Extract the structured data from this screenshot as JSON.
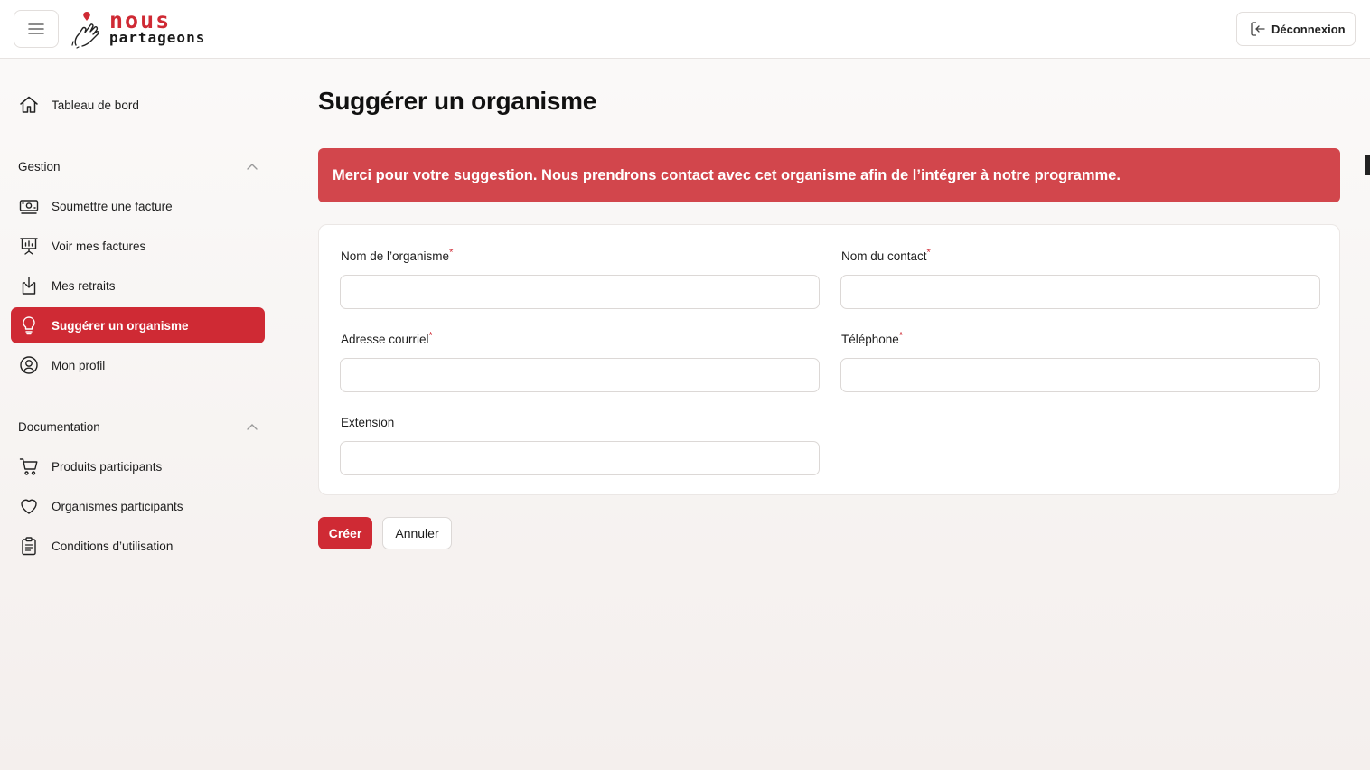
{
  "header": {
    "logo_line1": "nous",
    "logo_line2": "partageons",
    "logout_label": "Déconnexion"
  },
  "sidebar": {
    "dashboard_label": "Tableau de bord",
    "sections": [
      {
        "title": "Gestion",
        "items": [
          {
            "label": "Soumettre une facture",
            "icon": "money-icon"
          },
          {
            "label": "Voir mes factures",
            "icon": "invoice-chart-icon"
          },
          {
            "label": "Mes retraits",
            "icon": "withdraw-icon"
          },
          {
            "label": "Suggérer un organisme",
            "icon": "lightbulb-icon",
            "active": true
          },
          {
            "label": "Mon profil",
            "icon": "user-circle-icon"
          }
        ]
      },
      {
        "title": "Documentation",
        "items": [
          {
            "label": "Produits participants",
            "icon": "cart-icon"
          },
          {
            "label": "Organismes participants",
            "icon": "heart-icon"
          },
          {
            "label": "Conditions d’utilisation",
            "icon": "clipboard-icon"
          }
        ]
      }
    ]
  },
  "main": {
    "title": "Suggérer un organisme",
    "alert": "Merci pour votre suggestion. Nous prendrons contact avec cet organisme afin de l’intégrer à notre programme.",
    "form": {
      "org_name_label": "Nom de l’organisme",
      "contact_name_label": "Nom du contact",
      "email_label": "Adresse courriel",
      "phone_label": "Téléphone",
      "extension_label": "Extension",
      "required_mark": "*",
      "org_name_value": "",
      "contact_name_value": "",
      "email_value": "",
      "phone_value": "",
      "extension_value": ""
    },
    "create_label": "Créer",
    "cancel_label": "Annuler"
  },
  "colors": {
    "accent": "#cf2a34",
    "alert_bg": "#d2464c"
  }
}
